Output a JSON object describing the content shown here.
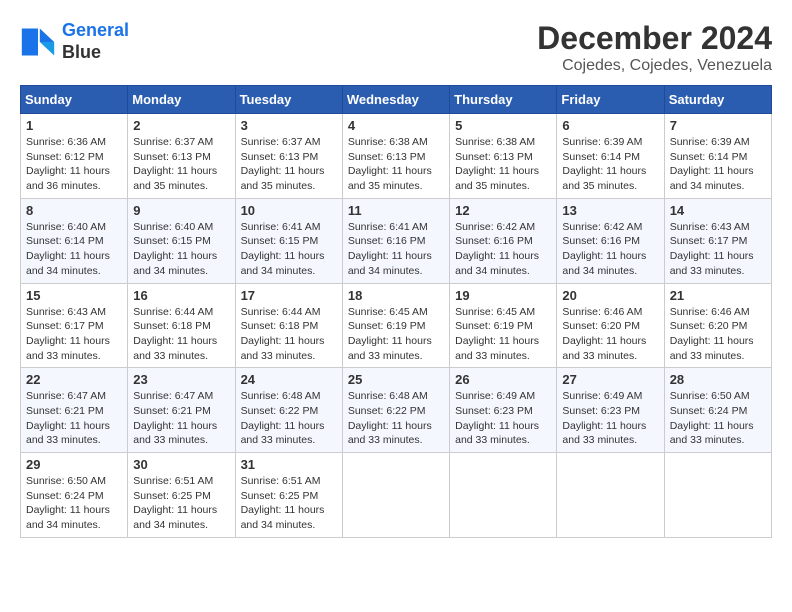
{
  "logo": {
    "line1": "General",
    "line2": "Blue"
  },
  "title": "December 2024",
  "location": "Cojedes, Cojedes, Venezuela",
  "days_of_week": [
    "Sunday",
    "Monday",
    "Tuesday",
    "Wednesday",
    "Thursday",
    "Friday",
    "Saturday"
  ],
  "weeks": [
    [
      {
        "day": "1",
        "sunrise": "6:36 AM",
        "sunset": "6:12 PM",
        "daylight": "11 hours and 36 minutes."
      },
      {
        "day": "2",
        "sunrise": "6:37 AM",
        "sunset": "6:13 PM",
        "daylight": "11 hours and 35 minutes."
      },
      {
        "day": "3",
        "sunrise": "6:37 AM",
        "sunset": "6:13 PM",
        "daylight": "11 hours and 35 minutes."
      },
      {
        "day": "4",
        "sunrise": "6:38 AM",
        "sunset": "6:13 PM",
        "daylight": "11 hours and 35 minutes."
      },
      {
        "day": "5",
        "sunrise": "6:38 AM",
        "sunset": "6:13 PM",
        "daylight": "11 hours and 35 minutes."
      },
      {
        "day": "6",
        "sunrise": "6:39 AM",
        "sunset": "6:14 PM",
        "daylight": "11 hours and 35 minutes."
      },
      {
        "day": "7",
        "sunrise": "6:39 AM",
        "sunset": "6:14 PM",
        "daylight": "11 hours and 34 minutes."
      }
    ],
    [
      {
        "day": "8",
        "sunrise": "6:40 AM",
        "sunset": "6:14 PM",
        "daylight": "11 hours and 34 minutes."
      },
      {
        "day": "9",
        "sunrise": "6:40 AM",
        "sunset": "6:15 PM",
        "daylight": "11 hours and 34 minutes."
      },
      {
        "day": "10",
        "sunrise": "6:41 AM",
        "sunset": "6:15 PM",
        "daylight": "11 hours and 34 minutes."
      },
      {
        "day": "11",
        "sunrise": "6:41 AM",
        "sunset": "6:16 PM",
        "daylight": "11 hours and 34 minutes."
      },
      {
        "day": "12",
        "sunrise": "6:42 AM",
        "sunset": "6:16 PM",
        "daylight": "11 hours and 34 minutes."
      },
      {
        "day": "13",
        "sunrise": "6:42 AM",
        "sunset": "6:16 PM",
        "daylight": "11 hours and 34 minutes."
      },
      {
        "day": "14",
        "sunrise": "6:43 AM",
        "sunset": "6:17 PM",
        "daylight": "11 hours and 33 minutes."
      }
    ],
    [
      {
        "day": "15",
        "sunrise": "6:43 AM",
        "sunset": "6:17 PM",
        "daylight": "11 hours and 33 minutes."
      },
      {
        "day": "16",
        "sunrise": "6:44 AM",
        "sunset": "6:18 PM",
        "daylight": "11 hours and 33 minutes."
      },
      {
        "day": "17",
        "sunrise": "6:44 AM",
        "sunset": "6:18 PM",
        "daylight": "11 hours and 33 minutes."
      },
      {
        "day": "18",
        "sunrise": "6:45 AM",
        "sunset": "6:19 PM",
        "daylight": "11 hours and 33 minutes."
      },
      {
        "day": "19",
        "sunrise": "6:45 AM",
        "sunset": "6:19 PM",
        "daylight": "11 hours and 33 minutes."
      },
      {
        "day": "20",
        "sunrise": "6:46 AM",
        "sunset": "6:20 PM",
        "daylight": "11 hours and 33 minutes."
      },
      {
        "day": "21",
        "sunrise": "6:46 AM",
        "sunset": "6:20 PM",
        "daylight": "11 hours and 33 minutes."
      }
    ],
    [
      {
        "day": "22",
        "sunrise": "6:47 AM",
        "sunset": "6:21 PM",
        "daylight": "11 hours and 33 minutes."
      },
      {
        "day": "23",
        "sunrise": "6:47 AM",
        "sunset": "6:21 PM",
        "daylight": "11 hours and 33 minutes."
      },
      {
        "day": "24",
        "sunrise": "6:48 AM",
        "sunset": "6:22 PM",
        "daylight": "11 hours and 33 minutes."
      },
      {
        "day": "25",
        "sunrise": "6:48 AM",
        "sunset": "6:22 PM",
        "daylight": "11 hours and 33 minutes."
      },
      {
        "day": "26",
        "sunrise": "6:49 AM",
        "sunset": "6:23 PM",
        "daylight": "11 hours and 33 minutes."
      },
      {
        "day": "27",
        "sunrise": "6:49 AM",
        "sunset": "6:23 PM",
        "daylight": "11 hours and 33 minutes."
      },
      {
        "day": "28",
        "sunrise": "6:50 AM",
        "sunset": "6:24 PM",
        "daylight": "11 hours and 33 minutes."
      }
    ],
    [
      {
        "day": "29",
        "sunrise": "6:50 AM",
        "sunset": "6:24 PM",
        "daylight": "11 hours and 34 minutes."
      },
      {
        "day": "30",
        "sunrise": "6:51 AM",
        "sunset": "6:25 PM",
        "daylight": "11 hours and 34 minutes."
      },
      {
        "day": "31",
        "sunrise": "6:51 AM",
        "sunset": "6:25 PM",
        "daylight": "11 hours and 34 minutes."
      },
      null,
      null,
      null,
      null
    ]
  ]
}
